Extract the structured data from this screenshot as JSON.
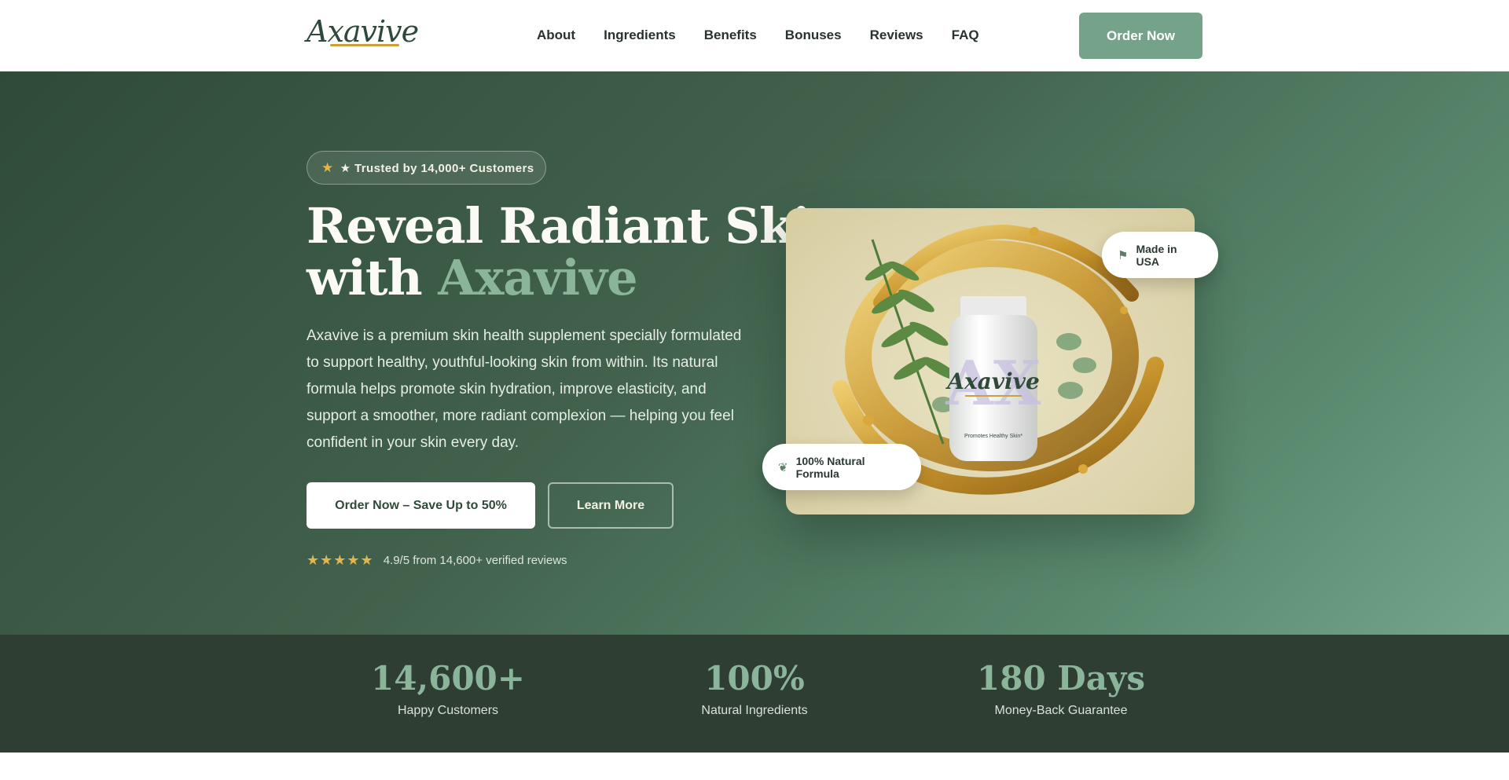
{
  "nav": {
    "logo": "Axavive",
    "links": [
      "About",
      "Ingredients",
      "Benefits",
      "Bonuses",
      "Reviews",
      "FAQ"
    ],
    "cta": "Order Now"
  },
  "hero": {
    "trust_badge": "★ Trusted by 14,000+ Customers",
    "headline_line1": "Reveal Radiant Skin",
    "headline_with": "with",
    "headline_accent": "Axavive",
    "description": "Axavive is a premium skin health supplement specially formulated to support healthy, youthful-looking skin from within. Its natural formula helps promote skin hydration, improve elasticity, and support a smoother, more radiant complexion — helping you feel confident in your skin every day.",
    "primary_button": "Order Now – Save Up to 50%",
    "secondary_button": "Learn More",
    "rating_stars": "★★★★★",
    "rating_text": "4.9/5 from 14,600+ verified reviews"
  },
  "product": {
    "bottle_brand": "Axavive",
    "bottle_letters": "AX",
    "bottle_tagline": "Promotes Healthy Skin*",
    "badge_usa": "Made in USA",
    "badge_natural": "100% Natural Formula"
  },
  "stats": [
    {
      "value": "14,600+",
      "label": "Happy Customers"
    },
    {
      "value": "100%",
      "label": "Natural Ingredients"
    },
    {
      "value": "180 Days",
      "label": "Money-Back Guarantee"
    }
  ],
  "colors": {
    "brand_green": "#74a38a",
    "accent_green": "#8ab59a",
    "dark_green": "#2f3e33",
    "star_gold": "#e4b54a"
  }
}
